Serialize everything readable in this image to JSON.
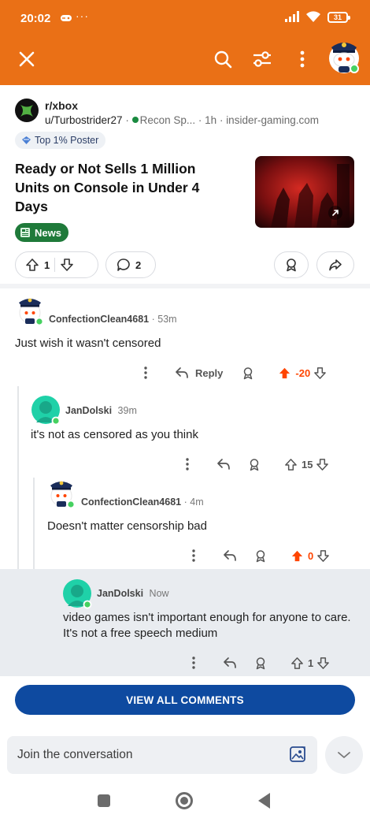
{
  "status_bar": {
    "time": "20:02",
    "dots": "···",
    "battery": "31"
  },
  "header": {
    "icons": [
      "close-icon",
      "search-icon",
      "filter-icon",
      "more-vertical-icon",
      "avatar"
    ],
    "background": "#ea7016"
  },
  "post": {
    "subreddit": "r/xbox",
    "author": "u/Turbostrider27",
    "author_flair": "Recon Sp...",
    "age": "1h",
    "domain": "insider-gaming.com",
    "poster_badge": "Top 1% Poster",
    "title": "Ready or Not Sells 1 Million Units on Console in Under 4 Days",
    "flair": "News",
    "votes": "1",
    "comments": "2"
  },
  "comments": [
    {
      "user": "ConfectionClean4681",
      "time": "53m",
      "body": "Just wish it wasn't censored",
      "reply_label": "Reply",
      "votes": "-20",
      "upvoted": true
    },
    {
      "user": "JanDolski",
      "time": "39m",
      "body": "it's not as censored as you think",
      "votes": "15",
      "upvoted": false
    },
    {
      "user": "ConfectionClean4681",
      "time": "4m",
      "body": "Doesn't matter censorship bad",
      "votes": "0",
      "upvoted": true
    },
    {
      "user": "JanDolski",
      "time": "Now",
      "body": "video games isn't important enough for anyone to care. It's not a free speech medium",
      "votes": "1",
      "upvoted": false
    }
  ],
  "view_all_label": "VIEW ALL COMMENTS",
  "composer": {
    "placeholder": "Join the conversation"
  },
  "colors": {
    "accent": "#ea7016",
    "upvote": "#ff4500",
    "button": "#0e4aa0",
    "flair": "#1f7a3a",
    "online": "#46d160",
    "highlight": "#e9ecf0"
  }
}
